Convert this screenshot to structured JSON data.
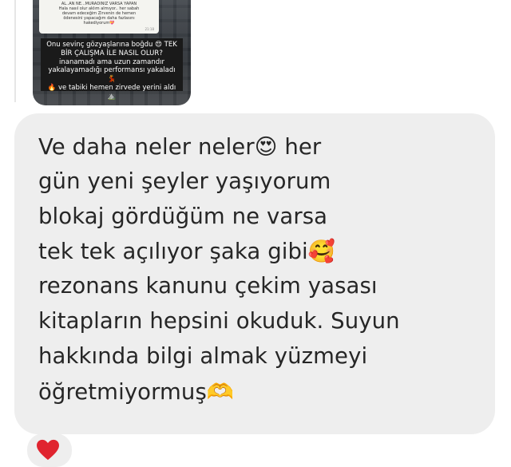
{
  "story": {
    "note_lines": [
      "AL..AN NE...MURADINIZ VARSA YAPAN",
      "Hala nasıl olur aklım almıyor.. her sabah",
      "devam edeceğim    Zirvenin de hemen",
      "ödenesini yapacağım daha fazlasını",
      "hakediyorum💝"
    ],
    "note_time": "21:18",
    "caption_lines": [
      "Onu sevinç gözyaşlarına boğdu 😍 TEK",
      "BİR ÇALIŞMA İLE NASIL OLUR?",
      "inanamadı ama uzun zamandır",
      "yakalayamadığı performansı yakaladı 💃",
      "🔥 ve tabiki hemen zirvede yerini aldı ⛰️"
    ]
  },
  "message": {
    "lines": [
      "Ve daha neler neler😍 her",
      "gün yeni şeyler yaşıyorum",
      "blokaj gördüğüm ne varsa",
      "tek tek açılıyor şaka gibi🥰",
      "rezonans kanunu çekim yasası",
      "kitapların hepsini okuduk. Suyun",
      "hakkında bilgi almak yüzmeyi",
      "öğretmiyormuş🫶"
    ]
  },
  "reaction": {
    "icon": "red-heart-icon",
    "color": "#e0242f"
  }
}
